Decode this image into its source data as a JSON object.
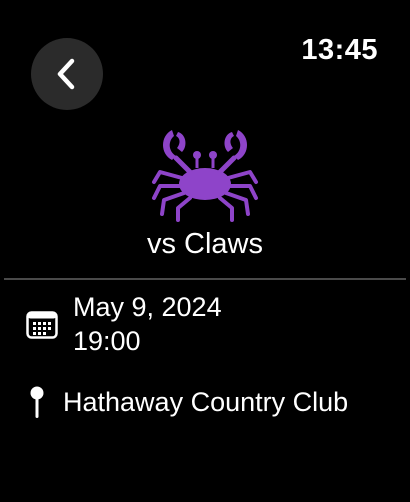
{
  "header": {
    "back_icon": "chevron-left-icon",
    "time": "13:45"
  },
  "event": {
    "opponent_icon": "crab-icon",
    "opponent_icon_color": "#8e44c9",
    "opponent": "vs Claws",
    "date": "May 9, 2024",
    "time": "19:00",
    "date_icon": "calendar-icon",
    "location_icon": "pin-icon",
    "location": "Hathaway Country Club"
  },
  "colors": {
    "background": "#000000",
    "button_bg": "#2b2b2b",
    "text": "#ffffff",
    "divider": "#4a4a4a"
  }
}
